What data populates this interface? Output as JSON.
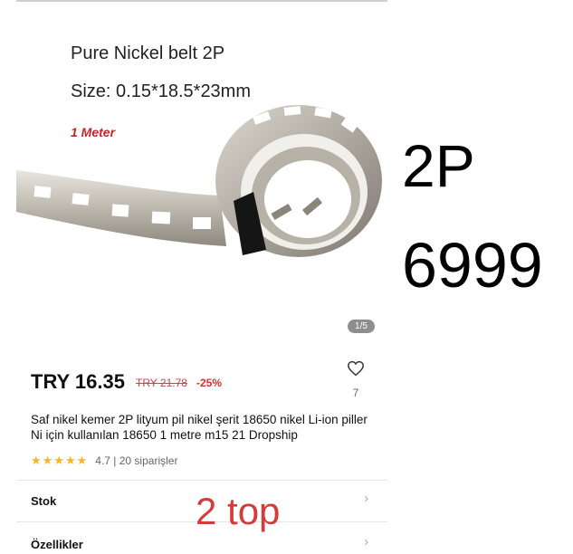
{
  "image": {
    "title": "Pure Nickel belt 2P",
    "size": "Size: 0.15*18.5*23mm",
    "length": "1 Meter",
    "pager": "1/5"
  },
  "overlay": {
    "label_2p": "2P",
    "price_note": "6999",
    "top_note": "2 top"
  },
  "product": {
    "price": "TRY 16.35",
    "old_price": "TRY 21.78",
    "discount": "-25%",
    "wishlist_count": "7",
    "description": "Saf nikel kemer 2P lityum pil nikel şerit 18650 nikel Li-ion piller Ni için kullanılan 18650 1 metre m15 21 Dropship",
    "stars": "★★★★★",
    "rating": 4.7,
    "rating_text": "4.7 | 20 siparişler"
  },
  "rows": {
    "stock_label": "Stok",
    "features_label": "Özellikler"
  },
  "colors": {
    "accent_red": "#d63b3b",
    "star": "#f5b622"
  },
  "icons": {
    "wishlist": "heart-icon",
    "row_chevron": "chevron-right-icon"
  }
}
